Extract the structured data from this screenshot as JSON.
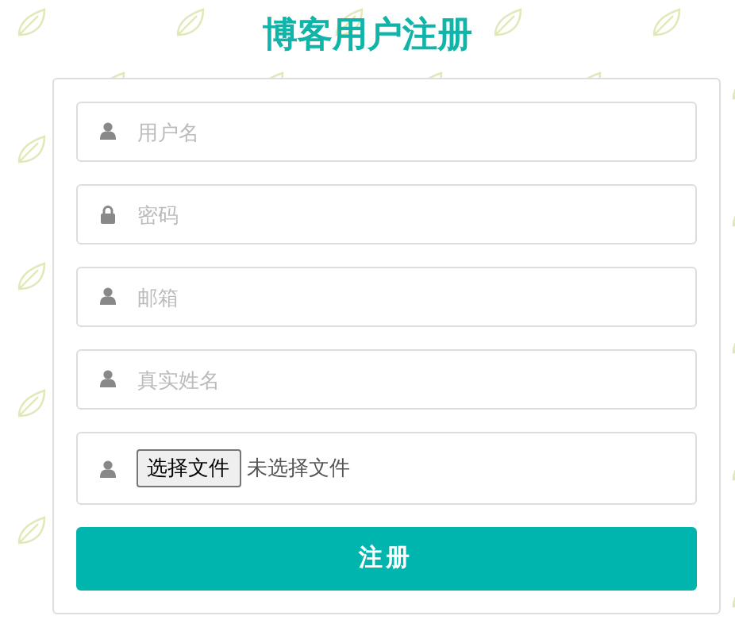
{
  "title": "博客用户注册",
  "fields": [
    {
      "kind": "text",
      "placeholder": "用户名"
    },
    {
      "kind": "password",
      "placeholder": "密码"
    },
    {
      "kind": "text",
      "placeholder": "邮箱"
    },
    {
      "kind": "text",
      "placeholder": "真实姓名"
    },
    {
      "kind": "file",
      "button": "选择文件",
      "status": "未选择文件"
    }
  ],
  "submit": "注册"
}
